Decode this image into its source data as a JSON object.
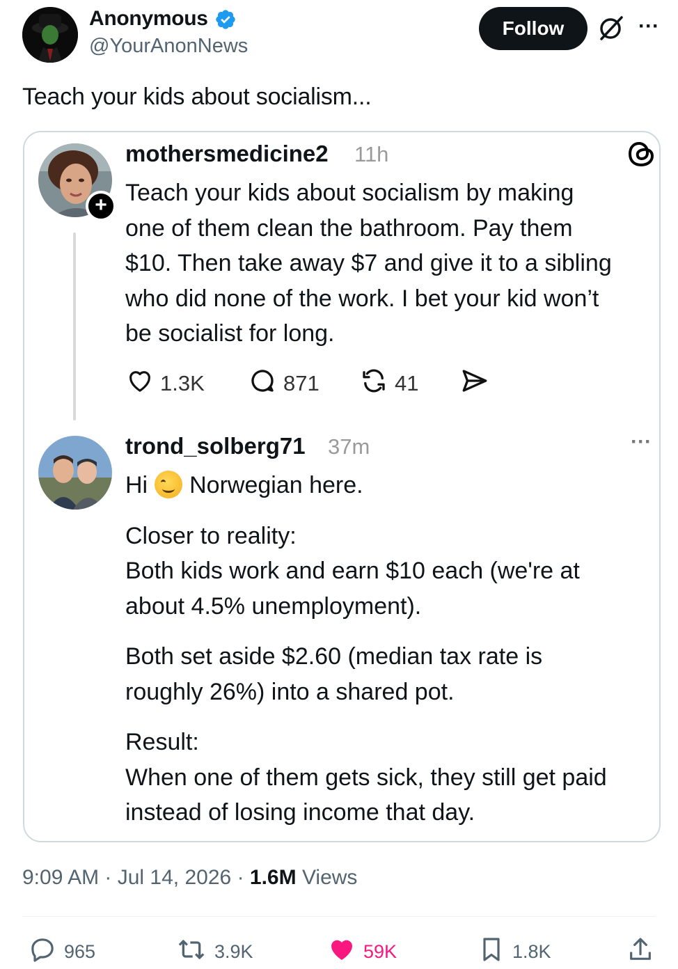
{
  "author": {
    "name": "Anonymous",
    "handle": "@YourAnonNews",
    "verified": true
  },
  "header": {
    "follow_label": "Follow",
    "grok_icon": "grok-icon",
    "more_icon": "more-icon"
  },
  "tweet": {
    "text": "Teach your kids about socialism..."
  },
  "embedded_threads": {
    "source_icon": "threads-icon",
    "post1": {
      "username": "mothersmedicine2",
      "time": "11h",
      "lines": [
        "Teach your kids about socialism by making",
        "one of them clean the bathroom.  Pay them",
        "$10.  Then take away $7 and give it to a sibling",
        "who did none of the work.  I bet your kid won’t",
        "be socialist for long."
      ],
      "stats": {
        "likes": "1.3K",
        "replies": "871",
        "reposts": "41"
      }
    },
    "post2": {
      "username": "trond_solberg71",
      "time": "37m",
      "greeting_before": "Hi",
      "greeting_after": "Norwegian here.",
      "para1": [
        "Closer to reality:",
        "Both kids work and earn $10 each (we're at",
        "about 4.5% unemployment)."
      ],
      "para2": [
        "Both set aside $2.60 (median tax rate is",
        "roughly 26%) into a shared pot."
      ],
      "para3": [
        "Result:",
        "When one of them gets sick, they still get paid",
        "instead of losing income that day."
      ]
    }
  },
  "meta": {
    "time": "9:09 AM",
    "date": "Jul 14, 2026",
    "views_count": "1.6M",
    "views_label": "Views"
  },
  "actions": {
    "replies": "965",
    "reposts": "3.9K",
    "likes": "59K",
    "bookmarks": "1.8K"
  },
  "colors": {
    "like_pink": "#f91880",
    "verified_blue": "#1d9bf0",
    "muted": "#536471"
  }
}
